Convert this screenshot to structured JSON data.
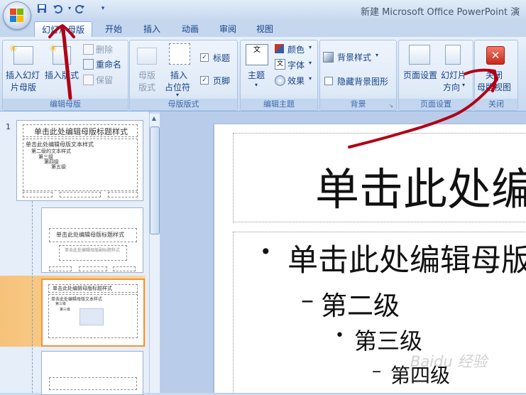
{
  "window": {
    "title": "新建 Microsoft Office PowerPoint 演"
  },
  "qat": {
    "save_icon": "save-icon",
    "undo_icon": "undo-icon",
    "redo_icon": "redo-icon",
    "customize_icon": "chevron-down-icon"
  },
  "tabs": [
    {
      "label": "幻灯片母版",
      "active": true
    },
    {
      "label": "开始"
    },
    {
      "label": "插入"
    },
    {
      "label": "动画"
    },
    {
      "label": "审阅"
    },
    {
      "label": "视图"
    }
  ],
  "ribbon": {
    "edit_master": {
      "label": "编辑母版",
      "insert_slide_master": [
        "插入幻灯",
        "片母版"
      ],
      "insert_layout": "插入版式",
      "delete": "删除",
      "rename": "重命名",
      "preserve": "保留"
    },
    "master_layout": {
      "label": "母版版式",
      "master_layout_btn": [
        "母版",
        "版式"
      ],
      "insert_placeholder": [
        "插入",
        "占位符"
      ],
      "title_checkbox": "标题",
      "footer_checkbox": "页脚"
    },
    "edit_theme": {
      "label": "编辑主题",
      "themes": "主题",
      "colors": "颜色",
      "fonts": "字体",
      "effects": "效果"
    },
    "background": {
      "label": "背景",
      "background_styles": "背景样式",
      "hide_background_graphics": "隐藏背景图形"
    },
    "page_setup": {
      "label": "页面设置",
      "page_setup": "页面设置",
      "slide_orientation": [
        "幻灯片",
        "方向"
      ]
    },
    "close": {
      "label": "关闭",
      "close_master_view": [
        "关闭",
        "母版视图"
      ]
    }
  },
  "thumbnails": {
    "slide_number": "1",
    "master_title": "单击此处编辑母版标题样式",
    "master_body": [
      "单击此处编辑母版文本样式",
      "第二级的文本样式",
      "第三级",
      "第四级",
      "第五级"
    ],
    "layout_title": "单击此处编辑母版标题样式",
    "layout_subtitle": "单击此处编辑母版副标题样式"
  },
  "slide": {
    "title": "单击此处编",
    "bullets": [
      "单击此处编辑母版",
      "第二级",
      "第三级",
      "第四级"
    ]
  },
  "watermark": "Baidu 经验"
}
